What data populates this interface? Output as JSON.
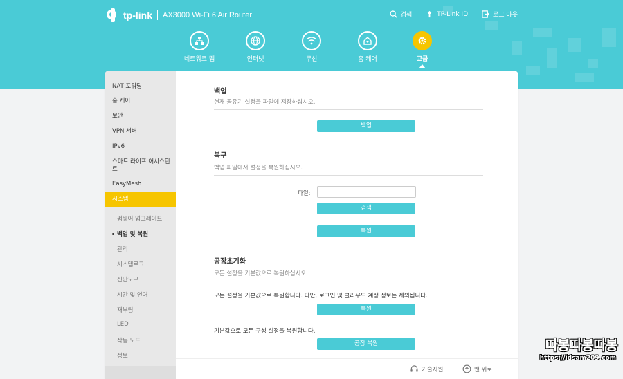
{
  "header": {
    "logo_text": "tp-link",
    "model": "AX3000 Wi-Fi 6 Air Router",
    "links": [
      {
        "label": "검색",
        "icon": "search-icon"
      },
      {
        "label": "TP-Link ID",
        "icon": "tplink-id-icon"
      },
      {
        "label": "로그 아웃",
        "icon": "logout-icon"
      }
    ]
  },
  "nav": {
    "items": [
      {
        "label": "네트워크 맵",
        "icon": "network-map-icon"
      },
      {
        "label": "인터넷",
        "icon": "globe-icon"
      },
      {
        "label": "무선",
        "icon": "wifi-icon"
      },
      {
        "label": "홈 케어",
        "icon": "home-care-icon"
      },
      {
        "label": "고급",
        "icon": "gear-icon",
        "active": true
      }
    ]
  },
  "sidebar": {
    "items": [
      {
        "label": "NAT 포워딩"
      },
      {
        "label": "홈 케어"
      },
      {
        "label": "보안"
      },
      {
        "label": "VPN 서버"
      },
      {
        "label": "IPv6"
      },
      {
        "label": "스마트 라이프 어시스턴트"
      },
      {
        "label": "EasyMesh"
      },
      {
        "label": "시스템",
        "active": true
      }
    ],
    "subitems": [
      {
        "label": "펌웨어 업그레이드"
      },
      {
        "label": "백업 및 복원",
        "current": true
      },
      {
        "label": "관리"
      },
      {
        "label": "시스템로그"
      },
      {
        "label": "진단도구"
      },
      {
        "label": "시간 및 언어"
      },
      {
        "label": "재부팅"
      },
      {
        "label": "LED"
      },
      {
        "label": "작동 모드"
      },
      {
        "label": "정보"
      }
    ]
  },
  "backup": {
    "title": "백업",
    "desc": "현재 공유기 설정을 파일에 저장하십시오.",
    "button": "백업"
  },
  "restore": {
    "title": "복구",
    "desc": "백업 파일에서 설정을 복원하십시오.",
    "file_label": "파일:",
    "file_value": "",
    "browse_button": "검색",
    "restore_button": "복원"
  },
  "factory": {
    "title": "공장초기화",
    "desc": "모든 설정을 기본값으로 복원하십시오.",
    "note1": "모든 설정을 기본값으로 복원합니다. 다만, 로그인 및 클라우드 계정 정보는 제외됩니다.",
    "restore_button": "복원",
    "note2": "기본값으로 모든 구성 설정을 복원합니다.",
    "factory_button": "공장 복원"
  },
  "footer": {
    "support": "기술지원",
    "back_to_top": "맨 위로"
  },
  "watermark": {
    "text": "따봉따봉따봉",
    "url": "https://idsam209.com"
  },
  "colors": {
    "header_bg": "#4acbd6",
    "accent": "#f6c500",
    "button": "#4acbd6"
  }
}
